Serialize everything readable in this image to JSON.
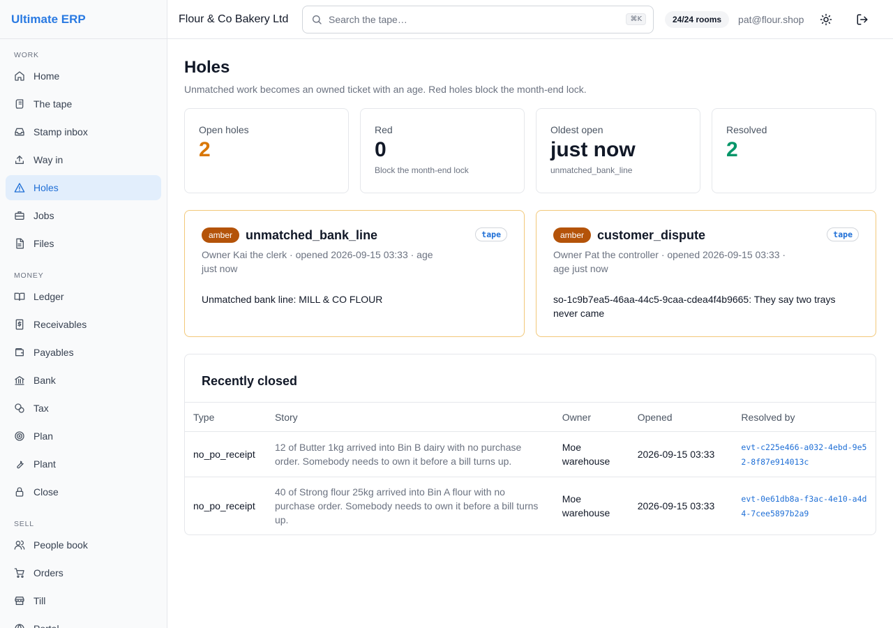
{
  "app": {
    "brand": "Ultimate ERP",
    "accent": "#2a7ae2"
  },
  "topbar": {
    "company": "Flour & Co Bakery Ltd",
    "search_placeholder": "Search the tape…",
    "shortcut": "⌘K",
    "rooms": "24/24 rooms",
    "user": "pat@flour.shop"
  },
  "sidebar": {
    "work_label": "WORK",
    "work": [
      {
        "label": "Home",
        "icon": "home-icon"
      },
      {
        "label": "The tape",
        "icon": "scroll-icon"
      },
      {
        "label": "Stamp inbox",
        "icon": "inbox-icon"
      },
      {
        "label": "Way in",
        "icon": "upload-icon"
      },
      {
        "label": "Holes",
        "icon": "warning-icon",
        "active": true
      },
      {
        "label": "Jobs",
        "icon": "briefcase-icon"
      },
      {
        "label": "Files",
        "icon": "file-icon"
      }
    ],
    "money_label": "MONEY",
    "money": [
      {
        "label": "Ledger",
        "icon": "book-icon"
      },
      {
        "label": "Receivables",
        "icon": "receipt-icon"
      },
      {
        "label": "Payables",
        "icon": "wallet-icon"
      },
      {
        "label": "Bank",
        "icon": "bank-icon"
      },
      {
        "label": "Tax",
        "icon": "coins-icon"
      },
      {
        "label": "Plan",
        "icon": "target-icon"
      },
      {
        "label": "Plant",
        "icon": "wrench-icon"
      },
      {
        "label": "Close",
        "icon": "lock-icon"
      }
    ],
    "sell_label": "SELL",
    "sell": [
      {
        "label": "People book",
        "icon": "users-icon"
      },
      {
        "label": "Orders",
        "icon": "cart-icon"
      },
      {
        "label": "Till",
        "icon": "store-icon"
      },
      {
        "label": "Portal",
        "icon": "globe-icon"
      }
    ]
  },
  "page": {
    "title": "Holes",
    "subtitle": "Unmatched work becomes an owned ticket with an age. Red holes block the month-end lock."
  },
  "stats": [
    {
      "label": "Open holes",
      "value": "2",
      "note": "",
      "color": "#d97706"
    },
    {
      "label": "Red",
      "value": "0",
      "note": "Block the month-end lock",
      "color": "#111827"
    },
    {
      "label": "Oldest open",
      "value": "just now",
      "note": "unmatched_bank_line",
      "color": "#111827"
    },
    {
      "label": "Resolved",
      "value": "2",
      "note": "",
      "color": "#059669"
    }
  ],
  "open_holes": [
    {
      "severity": "amber",
      "type": "unmatched_bank_line",
      "source": "tape",
      "meta": "Owner Kai the clerk · opened 2026-09-15 03:33 · age just now",
      "text": "Unmatched bank line: MILL & CO FLOUR"
    },
    {
      "severity": "amber",
      "type": "customer_dispute",
      "source": "tape",
      "meta": "Owner Pat the controller · opened 2026-09-15 03:33 · age just now",
      "text": "so-1c9b7ea5-46aa-44c5-9caa-cdea4f4b9665: They say two trays never came"
    }
  ],
  "recently_closed": {
    "title": "Recently closed",
    "columns": [
      "Type",
      "Story",
      "Owner",
      "Opened",
      "Resolved by"
    ],
    "rows": [
      {
        "type": "no_po_receipt",
        "story": "12 of Butter 1kg arrived into Bin B dairy with no purchase order. Somebody needs to own it before a bill turns up.",
        "owner": "Moe warehouse",
        "opened": "2026-09-15 03:33",
        "resolved_by": "evt-c225e466-a032-4ebd-9e52-8f87e914013c"
      },
      {
        "type": "no_po_receipt",
        "story": "40 of Strong flour 25kg arrived into Bin A flour with no purchase order. Somebody needs to own it before a bill turns up.",
        "owner": "Moe warehouse",
        "opened": "2026-09-15 03:33",
        "resolved_by": "evt-0e61db8a-f3ac-4e10-a4d4-7cee5897b2a9"
      }
    ]
  }
}
